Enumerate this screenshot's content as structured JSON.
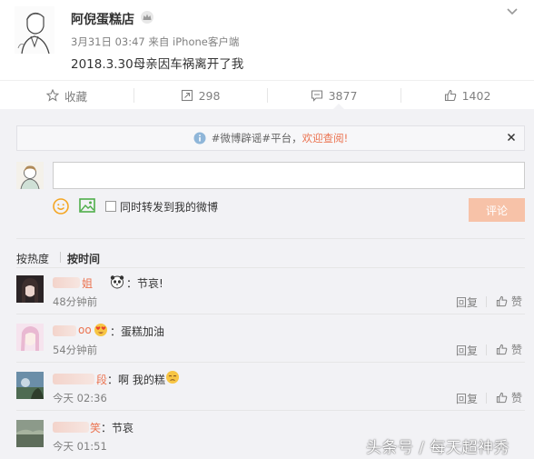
{
  "post": {
    "author": "阿倪蛋糕店",
    "meta": "3月31日 03:47 来自 iPhone客户端",
    "text": "2018.3.30母亲因车祸离开了我"
  },
  "actions": {
    "favorite_label": "收藏",
    "repost_count": "298",
    "comment_count": "3877",
    "like_count": "1402"
  },
  "notice": {
    "text": "#微博辟谣#平台，",
    "link": "欢迎查阅!"
  },
  "composer": {
    "input_value": "",
    "repost_label": "同时转发到我的微博",
    "submit_label": "评论"
  },
  "sort": {
    "hot": "按热度",
    "time": "按时间"
  },
  "comments": [
    {
      "name_visible": "姐",
      "text": "：节哀!",
      "time": "48分钟前"
    },
    {
      "name_visible": "oo",
      "text": "：蛋糕加油",
      "time": "54分钟前"
    },
    {
      "name_visible": "段",
      "text": "：啊 我的糕",
      "time": "今天 02:36"
    },
    {
      "name_visible": "笑",
      "text": "：节哀",
      "time": "今天 01:51"
    }
  ],
  "comment_actions": {
    "reply": "回复",
    "like": "赞"
  },
  "watermark": "头条号 / 每天超神秀",
  "colors": {
    "accent": "#eb7350",
    "button_disabled": "#f7c2a8",
    "panel_bg": "#f2f2f5"
  }
}
